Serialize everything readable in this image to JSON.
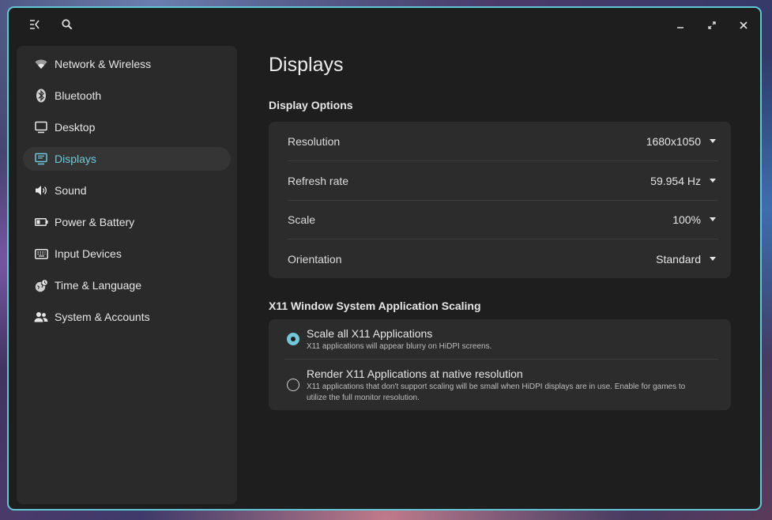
{
  "headerbar": {
    "collapse_icon": "sidebar-collapse-icon",
    "search_icon": "search-icon",
    "minimize_icon": "minimize-icon",
    "maximize_icon": "maximize-icon",
    "close_icon": "close-icon"
  },
  "sidebar": {
    "items": [
      {
        "label": "Network & Wireless",
        "icon": "wifi-icon"
      },
      {
        "label": "Bluetooth",
        "icon": "bluetooth-icon"
      },
      {
        "label": "Desktop",
        "icon": "monitor-icon"
      },
      {
        "label": "Displays",
        "icon": "display-icon",
        "active": true
      },
      {
        "label": "Sound",
        "icon": "speaker-icon"
      },
      {
        "label": "Power & Battery",
        "icon": "battery-icon"
      },
      {
        "label": "Input Devices",
        "icon": "keyboard-icon"
      },
      {
        "label": "Time & Language",
        "icon": "time-language-icon"
      },
      {
        "label": "System & Accounts",
        "icon": "users-icon"
      }
    ]
  },
  "main": {
    "title": "Displays",
    "display_options": {
      "heading": "Display Options",
      "rows": [
        {
          "label": "Resolution",
          "value": "1680x1050"
        },
        {
          "label": "Refresh rate",
          "value": "59.954 Hz"
        },
        {
          "label": "Scale",
          "value": "100%"
        },
        {
          "label": "Orientation",
          "value": "Standard"
        }
      ]
    },
    "x11_scaling": {
      "heading": "X11 Window System Application Scaling",
      "options": [
        {
          "label": "Scale all X11 Applications",
          "description": "X11 applications will appear blurry on HiDPI screens.",
          "selected": true
        },
        {
          "label": "Render X11 Applications at native resolution",
          "description": "X11 applications that don't support scaling will be small when HiDPI displays are in use. Enable for games to utilize the full monitor resolution.",
          "selected": false
        }
      ]
    }
  },
  "colors": {
    "accent": "#70c8d8",
    "window_border": "#62c6d6",
    "background": "#1e1e1e",
    "card": "#2c2c2c"
  }
}
